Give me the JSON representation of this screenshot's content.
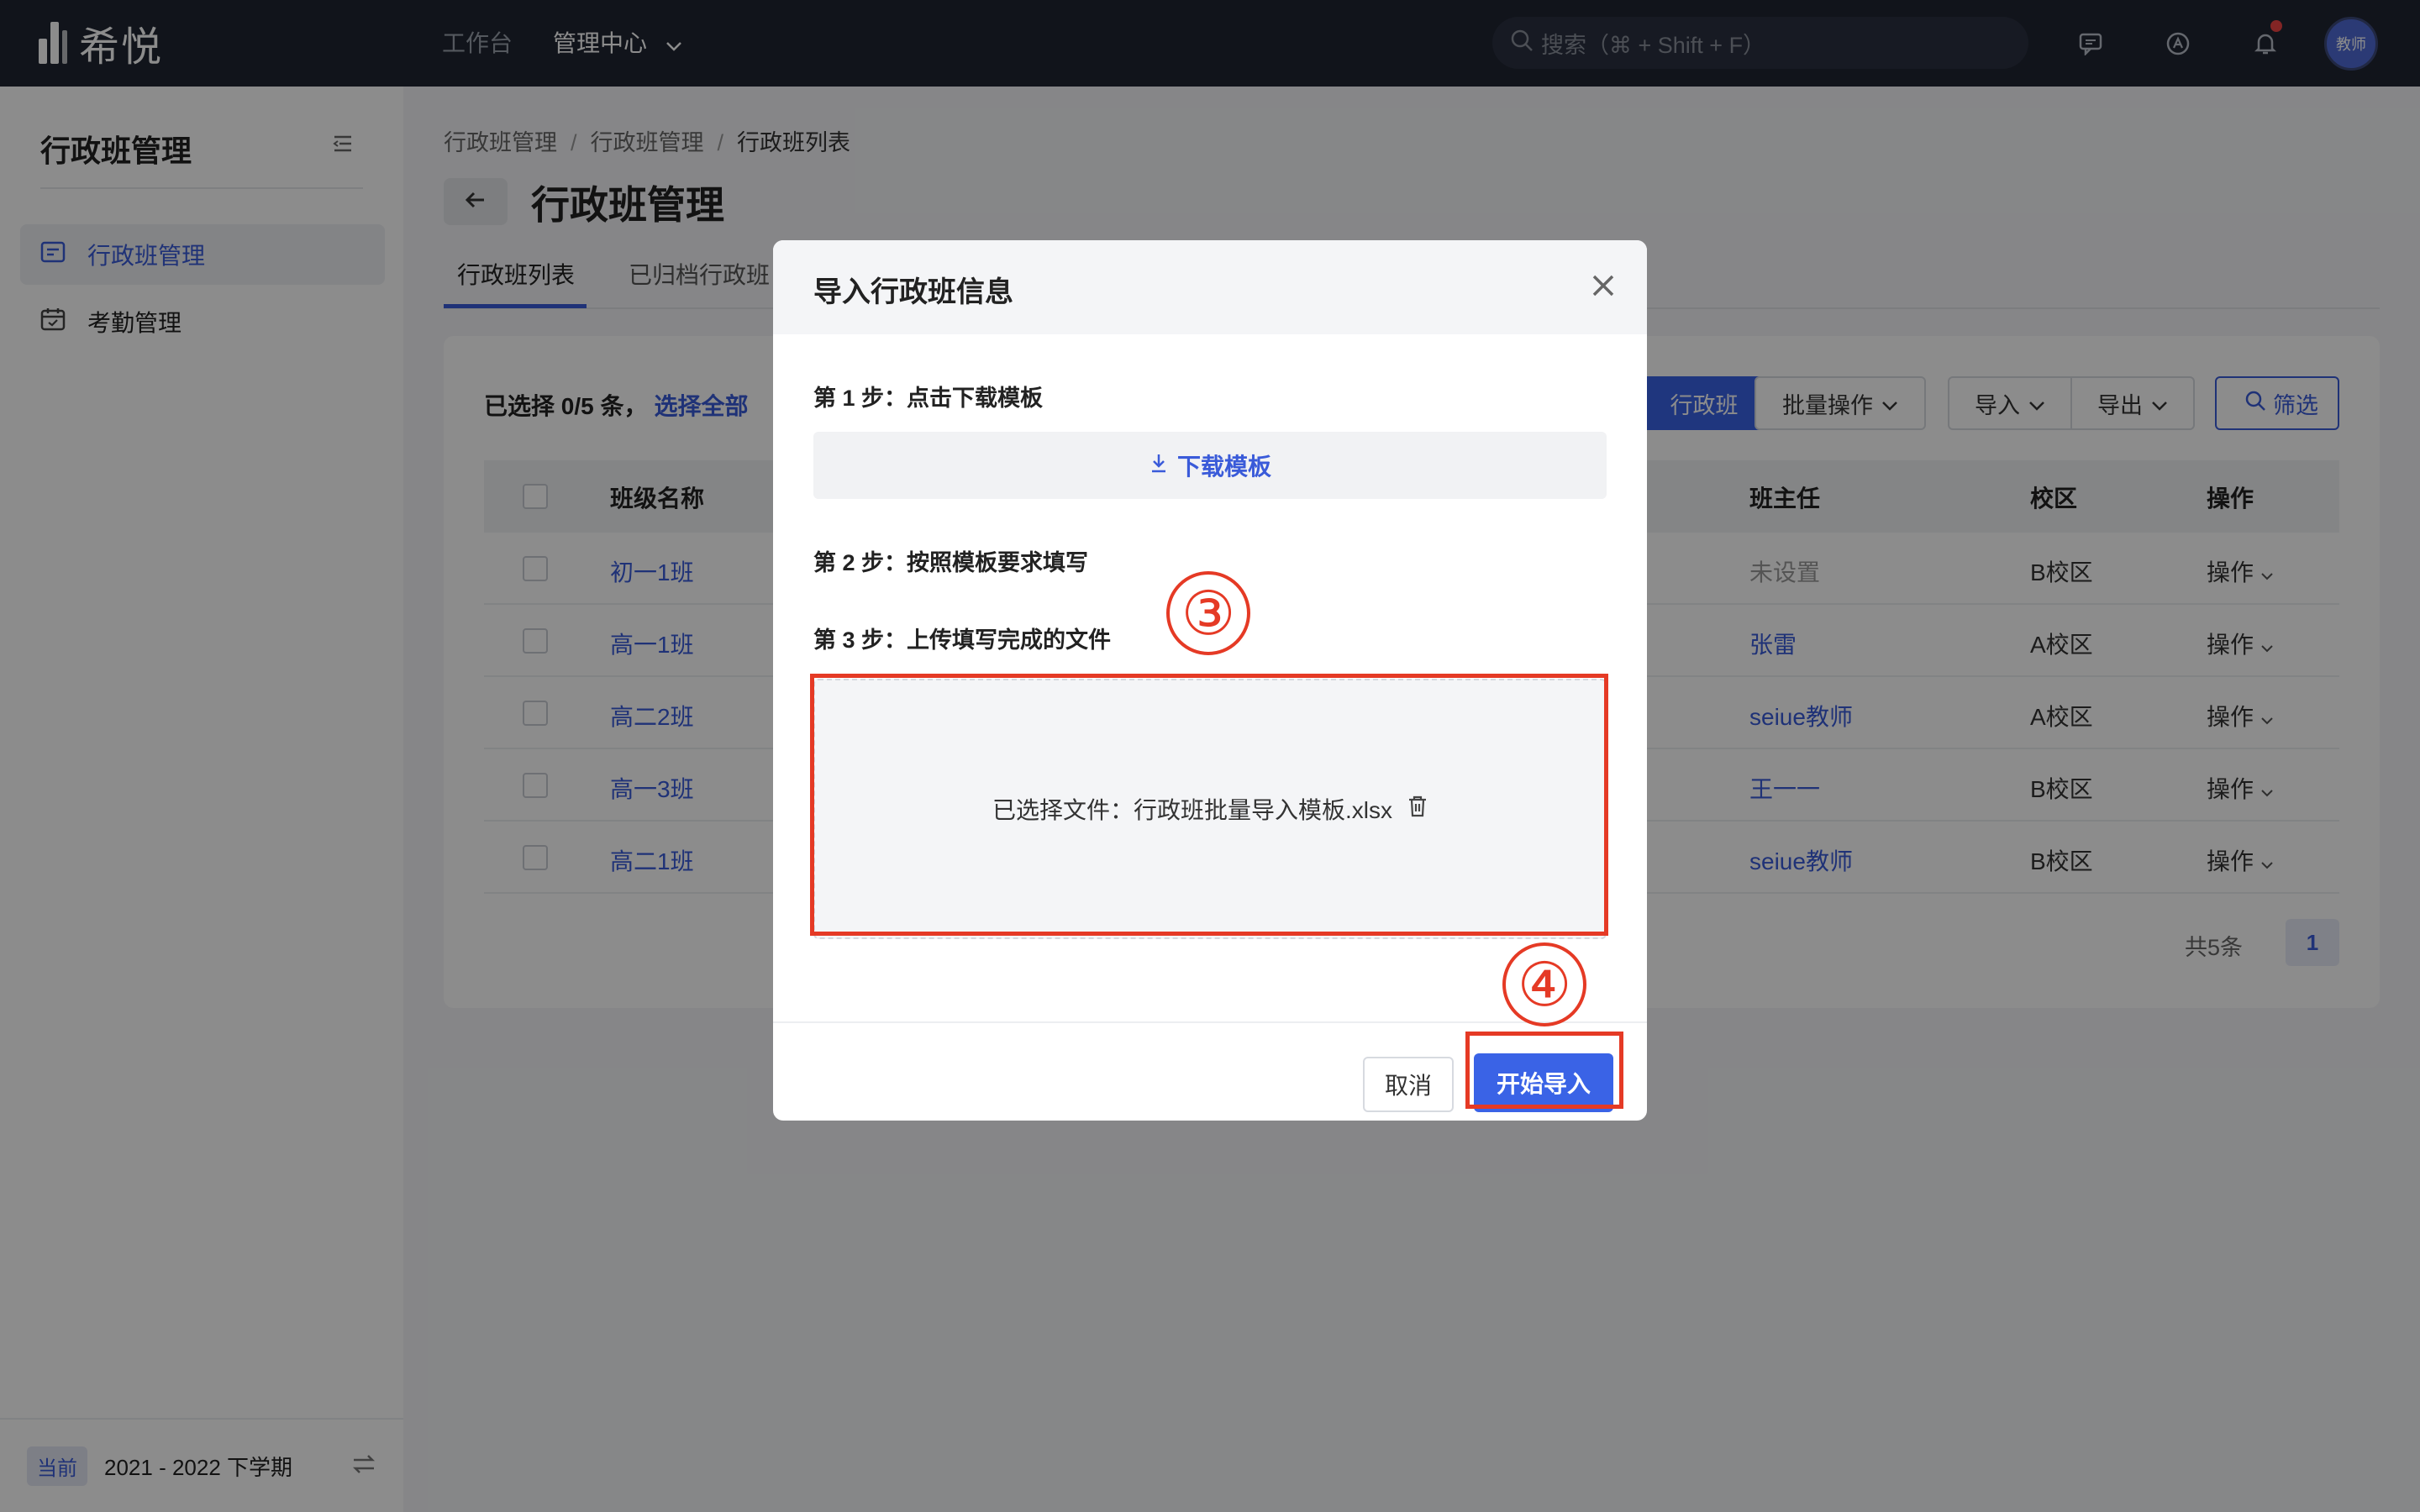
{
  "app": {
    "logo_text": "希悦"
  },
  "topbar": {
    "nav": [
      "工作台",
      "管理中心"
    ],
    "search_placeholder": "搜索（⌘ + Shift + F）",
    "avatar_label": "教师"
  },
  "sidebar": {
    "title": "行政班管理",
    "items": [
      {
        "label": "行政班管理",
        "icon": "list-icon",
        "active": true
      },
      {
        "label": "考勤管理",
        "icon": "calendar-icon",
        "active": false
      }
    ],
    "footer": {
      "badge": "当前",
      "term": "2021 - 2022 下学期"
    }
  },
  "breadcrumb": [
    "行政班管理",
    "行政班管理",
    "行政班列表"
  ],
  "page": {
    "title": "行政班管理",
    "tabs": [
      "行政班列表",
      "已归档行政班"
    ]
  },
  "toolbar": {
    "selection_text": "已选择 0/5 条，",
    "select_all": "选择全部",
    "add_button": "行政班",
    "batch_button": "批量操作",
    "import_button": "导入",
    "export_button": "导出",
    "filter_button": "筛选"
  },
  "table": {
    "headers": {
      "name": "班级名称",
      "teacher": "班主任",
      "campus": "校区",
      "action": "操作"
    },
    "rows": [
      {
        "name": "初一1班",
        "teacher": "未设置",
        "campus": "B校区",
        "action": "操作"
      },
      {
        "name": "高一1班",
        "teacher": "张雷",
        "campus": "A校区",
        "action": "操作"
      },
      {
        "name": "高二2班",
        "teacher": "seiue教师",
        "campus": "A校区",
        "action": "操作"
      },
      {
        "name": "高一3班",
        "teacher": "王一一",
        "campus": "B校区",
        "action": "操作"
      },
      {
        "name": "高二1班",
        "teacher": "seiue教师",
        "campus": "B校区",
        "action": "操作"
      }
    ],
    "pager": {
      "total": "共5条",
      "page": "1"
    }
  },
  "modal": {
    "title": "导入行政班信息",
    "step1": "第 1 步：点击下载模板",
    "download_label": "下载模板",
    "step2": "第 2 步：按照模板要求填写",
    "step3": "第 3 步：上传填写完成的文件",
    "selected_file": "已选择文件：行政班批量导入模板.xlsx",
    "cancel_label": "取消",
    "start_label": "开始导入"
  },
  "annotations": {
    "step3_marker": "③",
    "step4_marker": "④"
  },
  "colors": {
    "accent": "#3a63e6",
    "annotation": "#e53a25",
    "topbar": "#1f2532"
  }
}
